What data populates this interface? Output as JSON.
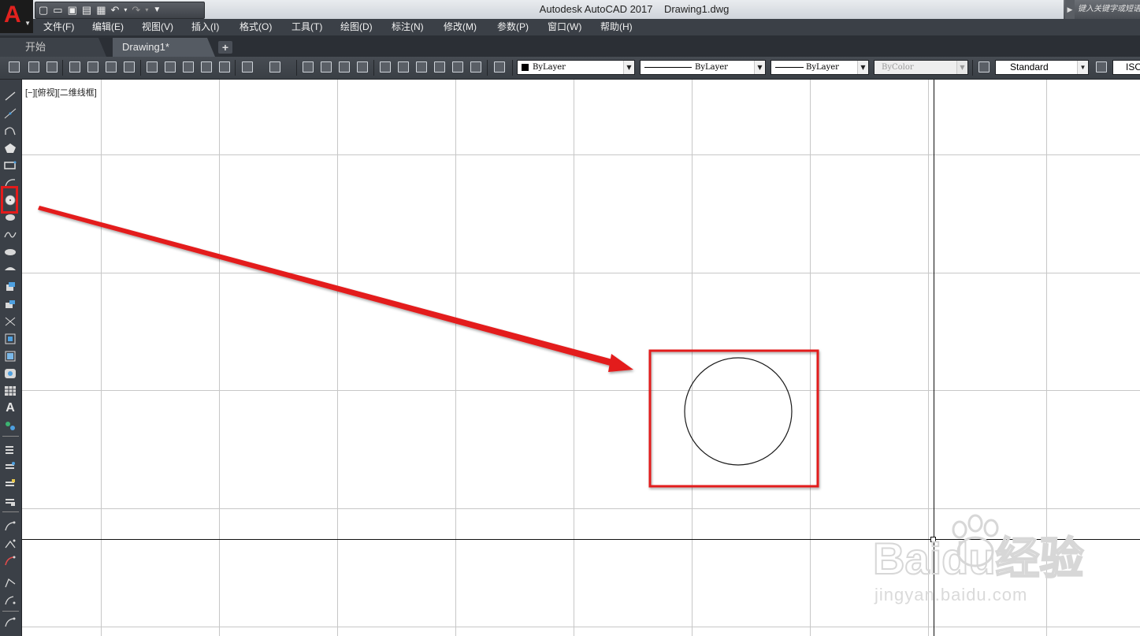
{
  "window": {
    "title": "Autodesk AutoCAD 2017    Drawing1.dwg",
    "search_placeholder": "键入关键字或短语"
  },
  "menubar": {
    "items": [
      "文件(F)",
      "编辑(E)",
      "视图(V)",
      "插入(I)",
      "格式(O)",
      "工具(T)",
      "绘图(D)",
      "标注(N)",
      "修改(M)",
      "参数(P)",
      "窗口(W)",
      "帮助(H)"
    ]
  },
  "tabs": {
    "start": "开始",
    "drawing": "Drawing1*",
    "add": "+"
  },
  "properties": {
    "color": "ByLayer",
    "linetype": "ByLayer",
    "lineweight": "ByLayer",
    "plotstyle": "ByColor",
    "text_style": "Standard",
    "dim_style": "ISO"
  },
  "viewport": {
    "label": "[−][俯视][二维线框]"
  },
  "watermark": {
    "brand": "Baidu经验",
    "url": "jingyan.baidu.com"
  },
  "colors": {
    "highlight": "#e31b1b",
    "palette_bg": "#3b4047",
    "menubar_bg": "#3b4047",
    "grid": "#c7c7c7"
  }
}
